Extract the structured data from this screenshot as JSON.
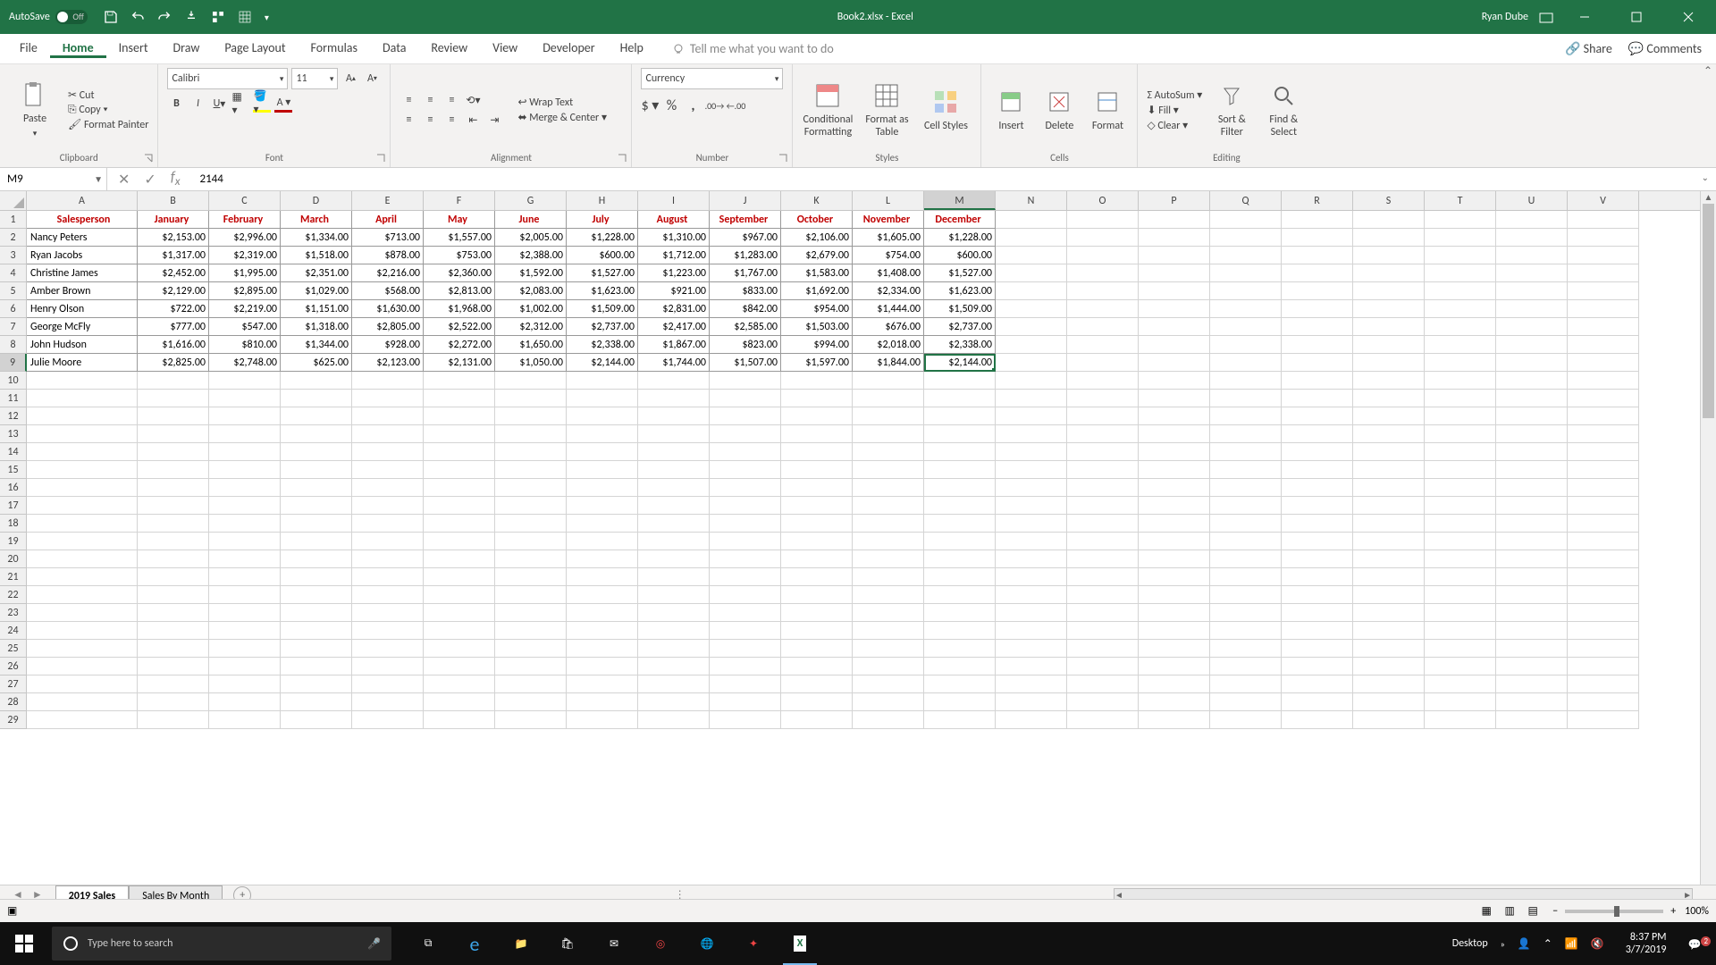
{
  "title_bar": {
    "autosave": "AutoSave",
    "toggle_state": "Off",
    "document": "Book2.xlsx  -  Excel",
    "user": "Ryan Dube"
  },
  "tabs": [
    "File",
    "Home",
    "Insert",
    "Draw",
    "Page Layout",
    "Formulas",
    "Data",
    "Review",
    "View",
    "Developer",
    "Help"
  ],
  "active_tab": "Home",
  "tellme": "Tell me what you want to do",
  "share": "Share",
  "comments": "Comments",
  "clipboard": {
    "paste": "Paste",
    "cut": "Cut",
    "copy": "Copy",
    "painter": "Format Painter",
    "label": "Clipboard"
  },
  "font": {
    "name": "Calibri",
    "size": "11",
    "label": "Font"
  },
  "number": {
    "format": "Currency",
    "label": "Number"
  },
  "alignment": {
    "wrap": "Wrap Text",
    "merge": "Merge & Center",
    "label": "Alignment"
  },
  "styles": {
    "cond": "Conditional Formatting",
    "table": "Format as Table",
    "cell": "Cell Styles",
    "label": "Styles"
  },
  "cells": {
    "insert": "Insert",
    "delete": "Delete",
    "format": "Format",
    "label": "Cells"
  },
  "editing": {
    "sum": "AutoSum",
    "fill": "Fill",
    "clear": "Clear",
    "sort": "Sort & Filter",
    "find": "Find & Select",
    "label": "Editing"
  },
  "namebox": "M9",
  "formula": "2144",
  "columns": [
    "A",
    "B",
    "C",
    "D",
    "E",
    "F",
    "G",
    "H",
    "I",
    "J",
    "K",
    "L",
    "M",
    "N",
    "O",
    "P",
    "Q",
    "R",
    "S",
    "T",
    "U",
    "V"
  ],
  "headers": [
    "Salesperson",
    "January",
    "February",
    "March",
    "April",
    "May",
    "June",
    "July",
    "August",
    "September",
    "October",
    "November",
    "December"
  ],
  "rows": [
    {
      "name": "Nancy Peters",
      "v": [
        "$2,153.00",
        "$2,996.00",
        "$1,334.00",
        "$713.00",
        "$1,557.00",
        "$2,005.00",
        "$1,228.00",
        "$1,310.00",
        "$967.00",
        "$2,106.00",
        "$1,605.00",
        "$1,228.00"
      ]
    },
    {
      "name": "Ryan Jacobs",
      "v": [
        "$1,317.00",
        "$2,319.00",
        "$1,518.00",
        "$878.00",
        "$753.00",
        "$2,388.00",
        "$600.00",
        "$1,712.00",
        "$1,283.00",
        "$2,679.00",
        "$754.00",
        "$600.00"
      ]
    },
    {
      "name": "Christine James",
      "v": [
        "$2,452.00",
        "$1,995.00",
        "$2,351.00",
        "$2,216.00",
        "$2,360.00",
        "$1,592.00",
        "$1,527.00",
        "$1,223.00",
        "$1,767.00",
        "$1,583.00",
        "$1,408.00",
        "$1,527.00"
      ]
    },
    {
      "name": "Amber Brown",
      "v": [
        "$2,129.00",
        "$2,895.00",
        "$1,029.00",
        "$568.00",
        "$2,813.00",
        "$2,083.00",
        "$1,623.00",
        "$921.00",
        "$833.00",
        "$1,692.00",
        "$2,334.00",
        "$1,623.00"
      ]
    },
    {
      "name": "Henry Olson",
      "v": [
        "$722.00",
        "$2,219.00",
        "$1,151.00",
        "$1,630.00",
        "$1,968.00",
        "$1,002.00",
        "$1,509.00",
        "$2,831.00",
        "$842.00",
        "$954.00",
        "$1,444.00",
        "$1,509.00"
      ]
    },
    {
      "name": "George McFly",
      "v": [
        "$777.00",
        "$547.00",
        "$1,318.00",
        "$2,805.00",
        "$2,522.00",
        "$2,312.00",
        "$2,737.00",
        "$2,417.00",
        "$2,585.00",
        "$1,503.00",
        "$676.00",
        "$2,737.00"
      ]
    },
    {
      "name": "John Hudson",
      "v": [
        "$1,616.00",
        "$810.00",
        "$1,344.00",
        "$928.00",
        "$2,272.00",
        "$1,650.00",
        "$2,338.00",
        "$1,867.00",
        "$823.00",
        "$994.00",
        "$2,018.00",
        "$2,338.00"
      ]
    },
    {
      "name": "Julie Moore",
      "v": [
        "$2,825.00",
        "$2,748.00",
        "$625.00",
        "$2,123.00",
        "$2,131.00",
        "$1,050.00",
        "$2,144.00",
        "$1,744.00",
        "$1,507.00",
        "$1,597.00",
        "$1,844.00",
        "$2,144.00"
      ]
    }
  ],
  "active_cell": {
    "row": 9,
    "col": "M"
  },
  "sheets": [
    "2019 Sales",
    "Sales By Month"
  ],
  "active_sheet": "2019 Sales",
  "zoom": "100%",
  "taskbar": {
    "search_placeholder": "Type here to search",
    "desktop": "Desktop",
    "time": "8:37 PM",
    "date": "3/7/2019"
  }
}
